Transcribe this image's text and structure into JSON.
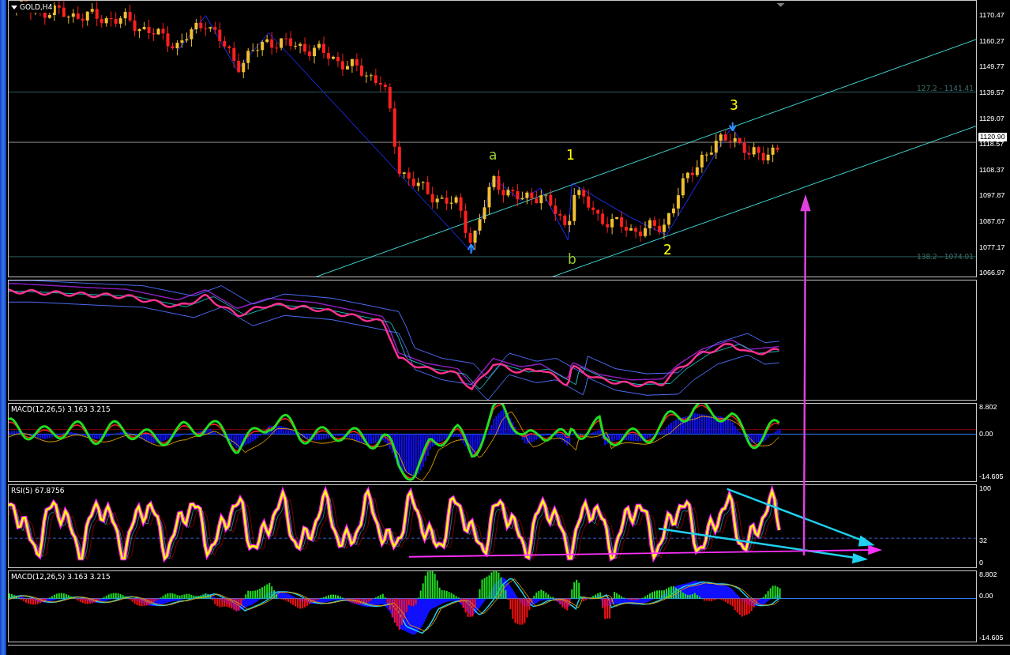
{
  "chart": {
    "title": "GOLD,H4",
    "price_axis": [
      "1170.47",
      "1160.27",
      "1149.77",
      "1139.57",
      "1129.07",
      "1118.57",
      "1108.37",
      "1097.87",
      "1087.67",
      "1077.17",
      "1066.97"
    ],
    "current_price": "1120.90",
    "levels": [
      {
        "label": "127.2 - 1141.41"
      },
      {
        "label": "138.2 - 1074.01"
      }
    ],
    "waves": [
      {
        "label": "a",
        "color": "#9acd32"
      },
      {
        "label": "b",
        "color": "#9acd32"
      },
      {
        "label": "1",
        "color": "#ffff00"
      },
      {
        "label": "2",
        "color": "#ffff00"
      },
      {
        "label": "3",
        "color": "#ffff00"
      }
    ]
  },
  "indicators": [
    {
      "kind": "bands"
    },
    {
      "kind": "macd",
      "title": "MACD(12,26,5) 3.163 3.215",
      "axis": [
        "8.802",
        "0.00",
        "-14.605"
      ]
    },
    {
      "kind": "rsi",
      "title": "RSI(5) 67.8756",
      "axis": [
        "100",
        "32",
        "0"
      ]
    },
    {
      "kind": "macd_histogram",
      "title": "MACD(12,26,5) 3.163 3.215",
      "axis": [
        "8.802",
        "0.00",
        "-14.605"
      ]
    }
  ]
}
